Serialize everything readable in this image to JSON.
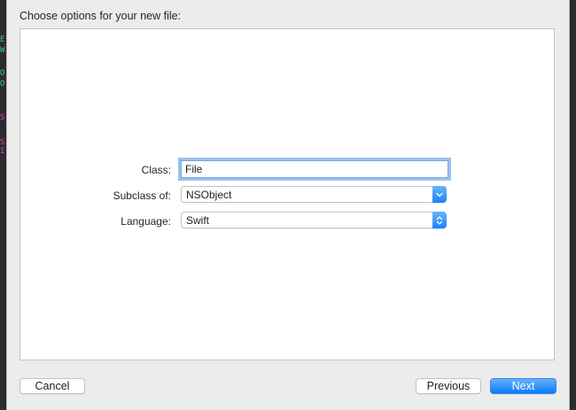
{
  "sheet": {
    "title": "Choose options for your new file:"
  },
  "form": {
    "class_label": "Class:",
    "class_value": "File",
    "subclass_label": "Subclass of:",
    "subclass_value": "NSObject",
    "language_label": "Language:",
    "language_value": "Swift"
  },
  "buttons": {
    "cancel": "Cancel",
    "previous": "Previous",
    "next": "Next"
  },
  "colors": {
    "accent": "#1a82fb",
    "sheet_background": "#ececec",
    "panel_background": "#ffffff",
    "editor_background": "#2b2b30"
  },
  "icons": {
    "subclass_popup": "chevron-down-icon",
    "language_popup": "up-down-chevron-icon"
  }
}
